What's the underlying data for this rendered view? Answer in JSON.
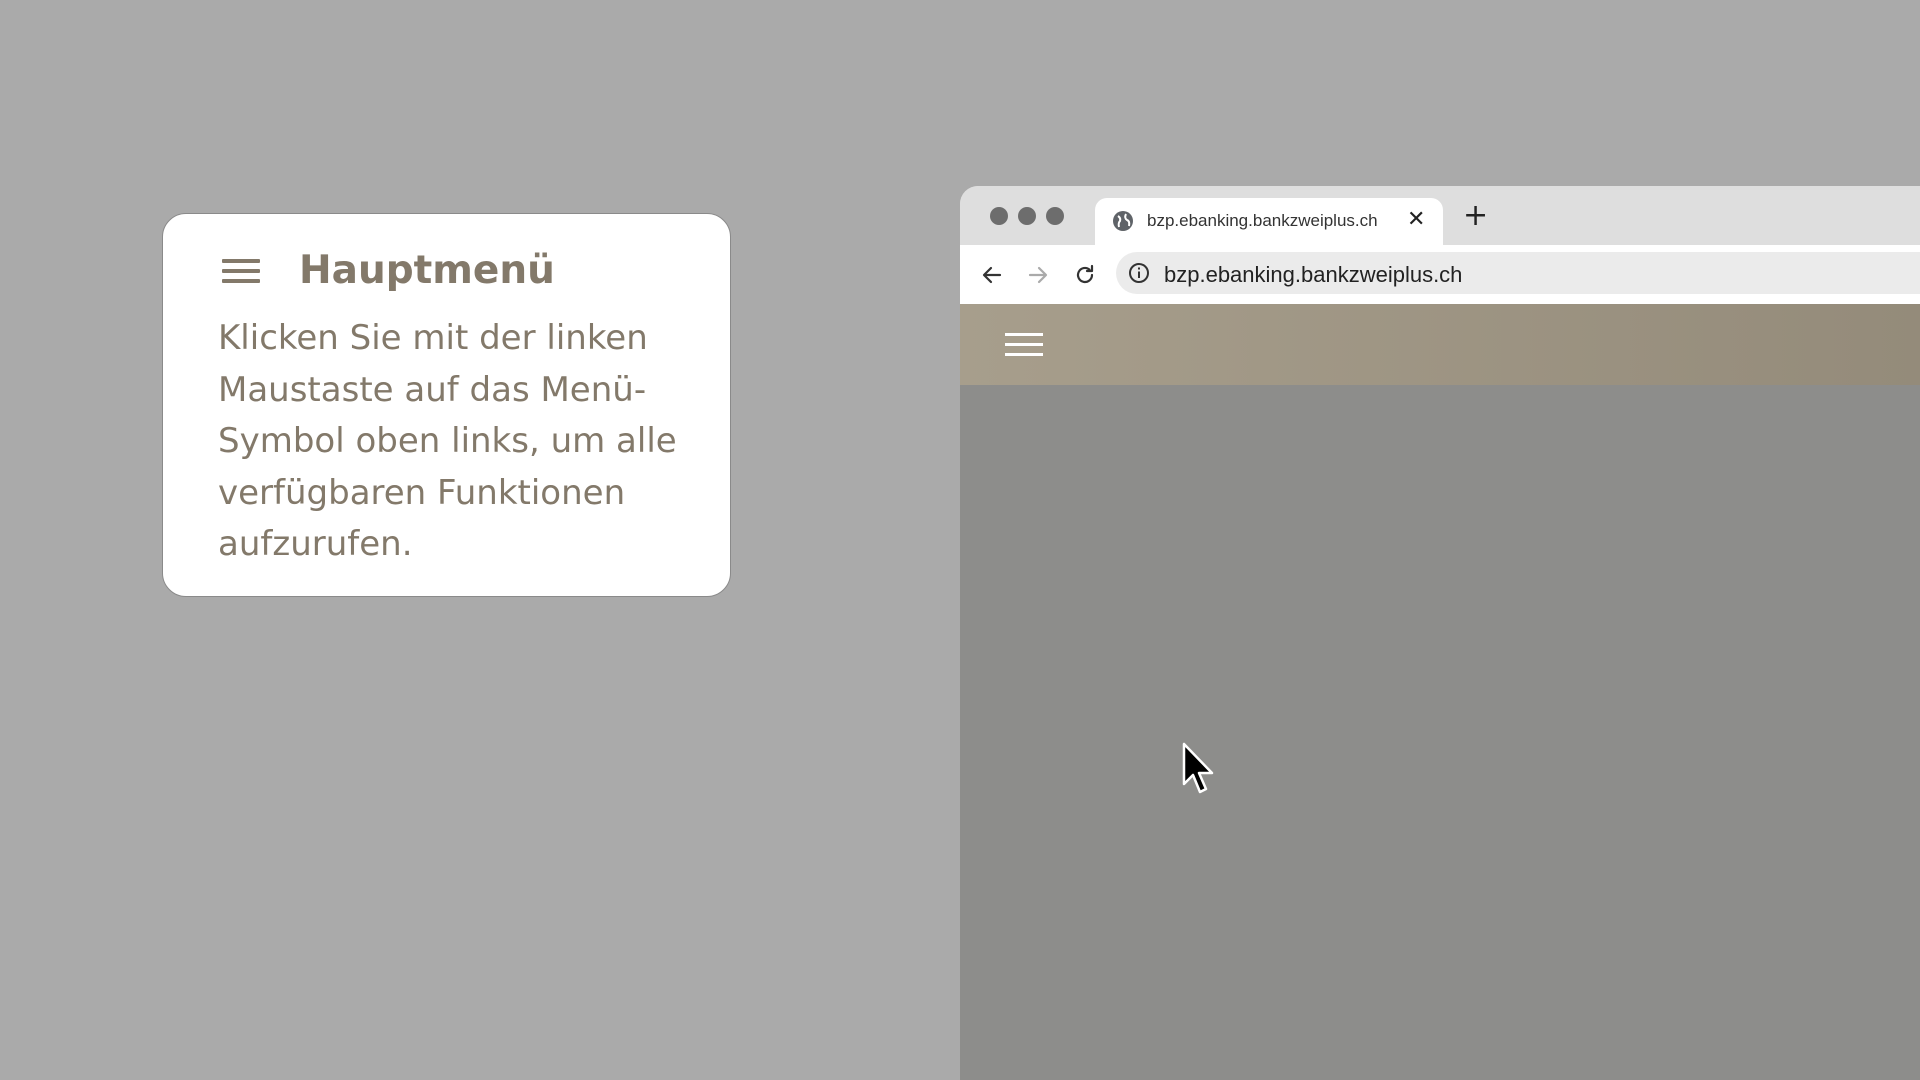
{
  "tooltip": {
    "title": "Hauptmenü",
    "body": "Klicken Sie mit der linken Maustaste auf das Menü-Symbol oben links, um alle verfügbaren Funktionen aufzurufen.",
    "icon": "hamburger-menu-icon"
  },
  "browser": {
    "tab": {
      "title": "bzp.ebanking.bankzweiplus.ch",
      "close_label": "✕",
      "icon": "globe-icon"
    },
    "new_tab_label": "+",
    "address_bar": {
      "url": "bzp.ebanking.bankzweiplus.ch",
      "icon": "info-icon"
    },
    "nav_icons": [
      "back-arrow-icon",
      "forward-arrow-icon",
      "reload-icon"
    ]
  },
  "site": {
    "menu_icon": "hamburger-menu-icon"
  },
  "colors": {
    "background": "#aaaaaa",
    "accent_text": "#83796a",
    "header_gradient_start": "#a79e8c",
    "header_gradient_end": "#948b7a",
    "page_content": "#8d8d8b"
  }
}
